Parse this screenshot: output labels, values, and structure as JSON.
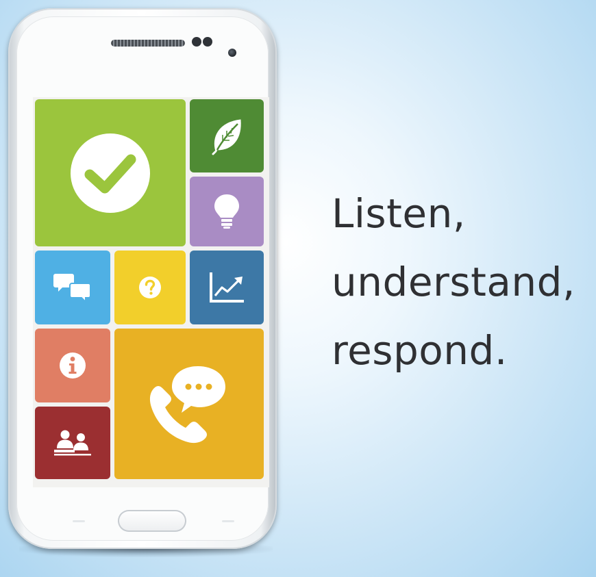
{
  "headline": {
    "line1": "Listen,",
    "line2": "understand,",
    "line3": "respond."
  },
  "tiles": [
    {
      "id": "checkmark",
      "icon": "checkmark-icon",
      "color": "#9bc53d"
    },
    {
      "id": "leaf",
      "icon": "leaf-icon",
      "color": "#4f8b34"
    },
    {
      "id": "lightbulb",
      "icon": "lightbulb-icon",
      "color": "#a98cc4"
    },
    {
      "id": "chat",
      "icon": "chat-bubbles-icon",
      "color": "#4fb0e4"
    },
    {
      "id": "help",
      "icon": "question-icon",
      "color": "#f2cf2b"
    },
    {
      "id": "chart",
      "icon": "line-chart-icon",
      "color": "#3d78a6"
    },
    {
      "id": "info",
      "icon": "info-icon",
      "color": "#e07e64"
    },
    {
      "id": "phone-chat",
      "icon": "phone-with-speech-bubble-icon",
      "color": "#e8b124"
    },
    {
      "id": "meeting",
      "icon": "people-meeting-icon",
      "color": "#9b2f31"
    }
  ],
  "colors": {
    "headline_text": "#2f3033",
    "background_highlight": "#ffffff",
    "background_edge": "#a9d4f0"
  }
}
